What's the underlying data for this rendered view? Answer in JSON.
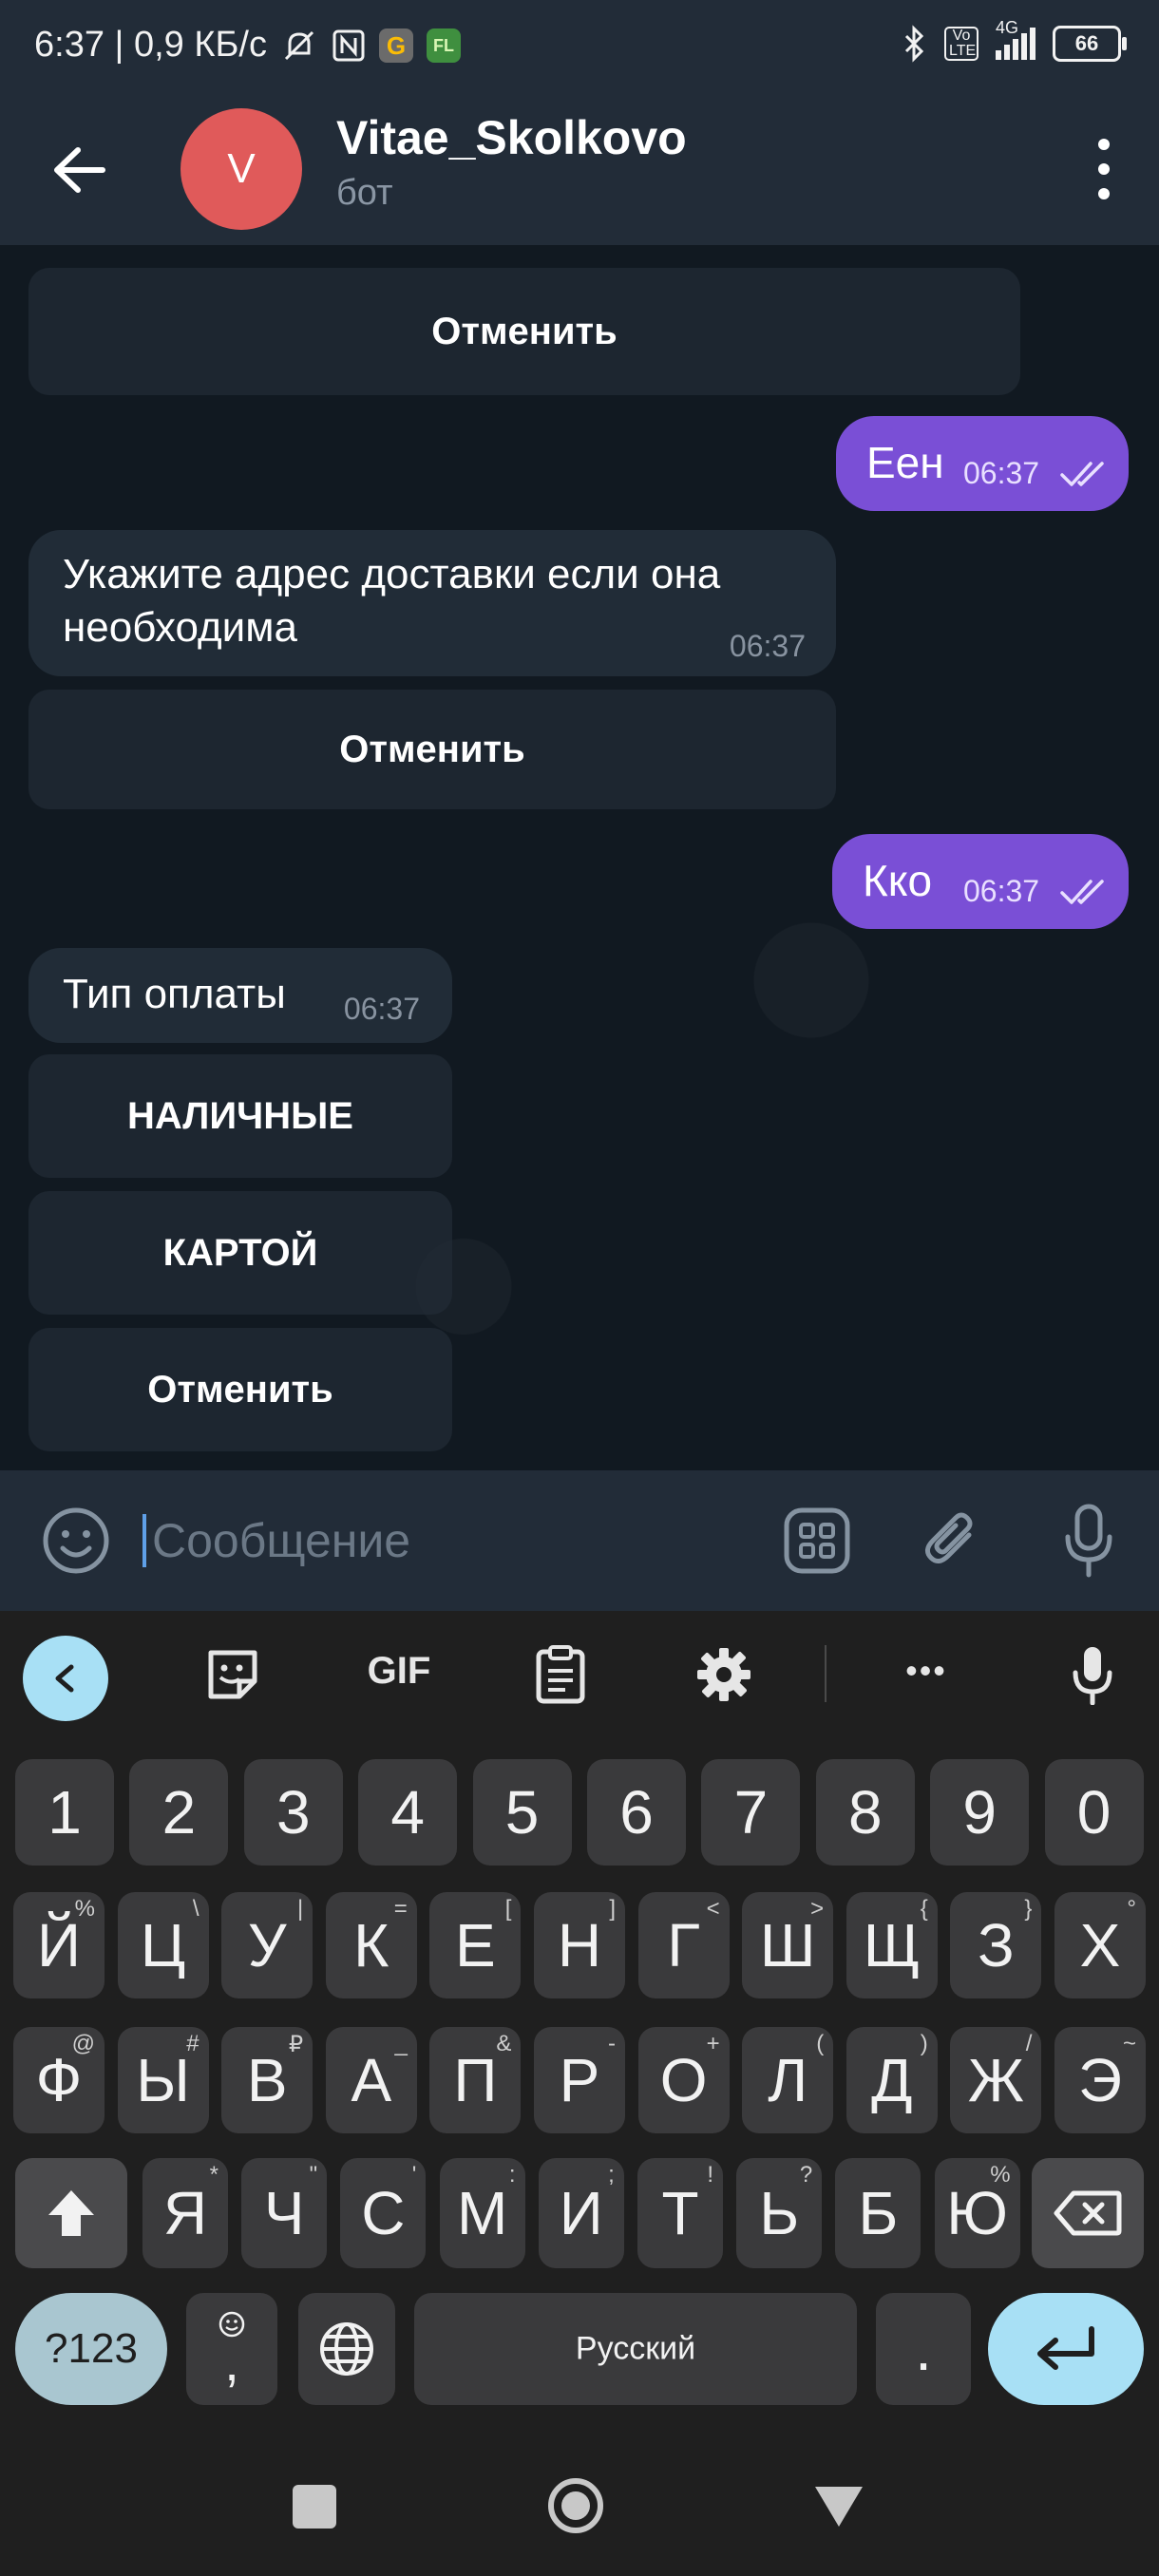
{
  "status": {
    "left_text": "6:37 | 0,9 КБ/с",
    "net": "4G",
    "volte": "Vo LTE",
    "battery": "66",
    "icons": [
      "silent-icon",
      "nfc-icon",
      "google-icon",
      "fl-icon",
      "bluetooth-icon",
      "signal-icon"
    ]
  },
  "header": {
    "avatar_letter": "V",
    "title": "Vitae_Skolkovo",
    "subtitle": "бот"
  },
  "chat": {
    "kb1_cancel": "Отменить",
    "out1": {
      "text": "Еен",
      "time": "06:37"
    },
    "in1": {
      "text_line1": "Укажите адрес доставки если она",
      "text_line2": "необходима",
      "time": "06:37"
    },
    "kb2_cancel": "Отменить",
    "out2": {
      "text": "Кко",
      "time": "06:37"
    },
    "in2": {
      "text": "Тип оплаты",
      "time": "06:37"
    },
    "kb3": [
      "НАЛИЧНЫЕ",
      "КАРТОЙ",
      "Отменить"
    ]
  },
  "composer": {
    "placeholder": "Сообщение"
  },
  "keyboard": {
    "toolbar": {
      "gif": "GIF",
      "more": "•••"
    },
    "row0": [
      "1",
      "2",
      "3",
      "4",
      "5",
      "6",
      "7",
      "8",
      "9",
      "0"
    ],
    "row1": [
      [
        "Й",
        "%"
      ],
      [
        "Ц",
        "\\"
      ],
      [
        "У",
        "|"
      ],
      [
        "К",
        "="
      ],
      [
        "Е",
        "["
      ],
      [
        "Н",
        "]"
      ],
      [
        "Г",
        "<"
      ],
      [
        "Ш",
        ">"
      ],
      [
        "Щ",
        "{"
      ],
      [
        "З",
        "}"
      ],
      [
        "Х",
        "°"
      ]
    ],
    "row2": [
      [
        "Ф",
        "@"
      ],
      [
        "Ы",
        "#"
      ],
      [
        "В",
        "₽"
      ],
      [
        "А",
        "_"
      ],
      [
        "П",
        "&"
      ],
      [
        "Р",
        "-"
      ],
      [
        "О",
        "+"
      ],
      [
        "Л",
        "("
      ],
      [
        "Д",
        ")"
      ],
      [
        "Ж",
        "/"
      ],
      [
        "Э",
        "~"
      ]
    ],
    "row3": [
      [
        "Я",
        "*"
      ],
      [
        "Ч",
        "\""
      ],
      [
        "С",
        "'"
      ],
      [
        "М",
        ":"
      ],
      [
        "И",
        ";"
      ],
      [
        "Т",
        "!"
      ],
      [
        "Ь",
        "?"
      ],
      [
        "Б",
        ""
      ],
      [
        "Ю",
        "%"
      ]
    ],
    "sym": "?123",
    "comma": ",",
    "space": "Русский",
    "period": "."
  },
  "colors": {
    "accent": "#7a4fd6",
    "enter": "#a8e0f5"
  }
}
